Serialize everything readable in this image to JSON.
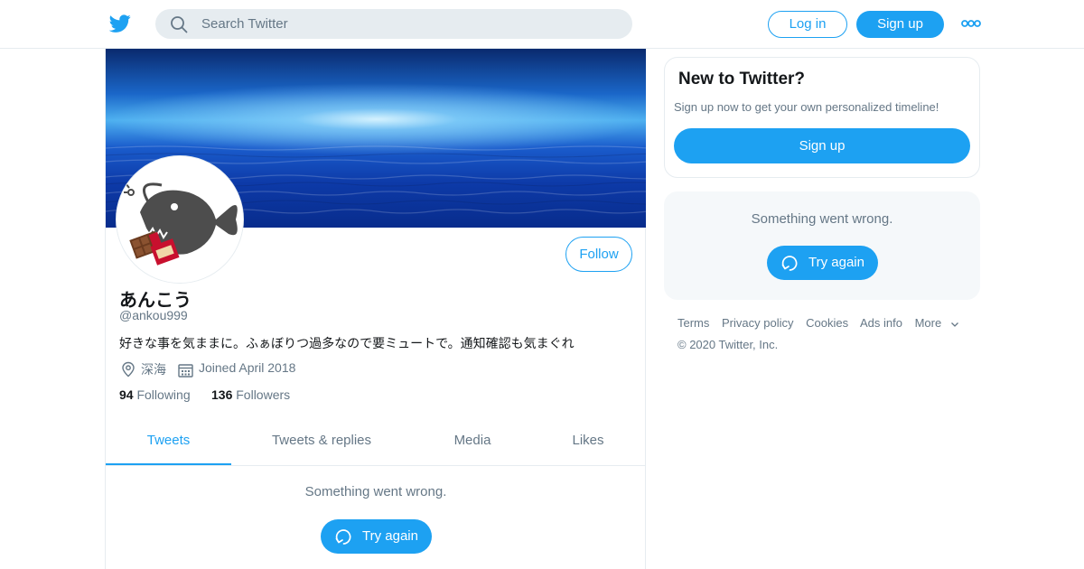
{
  "header": {
    "search_placeholder": "Search Twitter",
    "login_label": "Log in",
    "signup_label": "Sign up"
  },
  "profile": {
    "name": "あんこう",
    "handle": "@ankou999",
    "bio": "好きな事を気ままに。ふぁぼりつ過多なので要ミュートで。通知確認も気まぐれ",
    "location": "深海",
    "joined": "Joined April 2018",
    "following_count": "94",
    "following_label": "Following",
    "followers_count": "136",
    "followers_label": "Followers",
    "follow_label": "Follow"
  },
  "tabs": [
    {
      "label": "Tweets",
      "active": true
    },
    {
      "label": "Tweets & replies",
      "active": false
    },
    {
      "label": "Media",
      "active": false
    },
    {
      "label": "Likes",
      "active": false
    }
  ],
  "timeline": {
    "error_message": "Something went wrong.",
    "retry_label": "Try again"
  },
  "sidebar": {
    "new_title": "New to Twitter?",
    "new_subtitle": "Sign up now to get your own personalized timeline!",
    "signup_label": "Sign up",
    "error_message": "Something went wrong.",
    "retry_label": "Try again"
  },
  "footer": {
    "links": [
      "Terms",
      "Privacy policy",
      "Cookies",
      "Ads info",
      "More"
    ],
    "copyright": "© 2020 Twitter, Inc."
  },
  "colors": {
    "accent": "#1da1f2",
    "muted_text": "#657786",
    "border": "#e6ecf0",
    "panel_bg": "#f5f8fa"
  }
}
